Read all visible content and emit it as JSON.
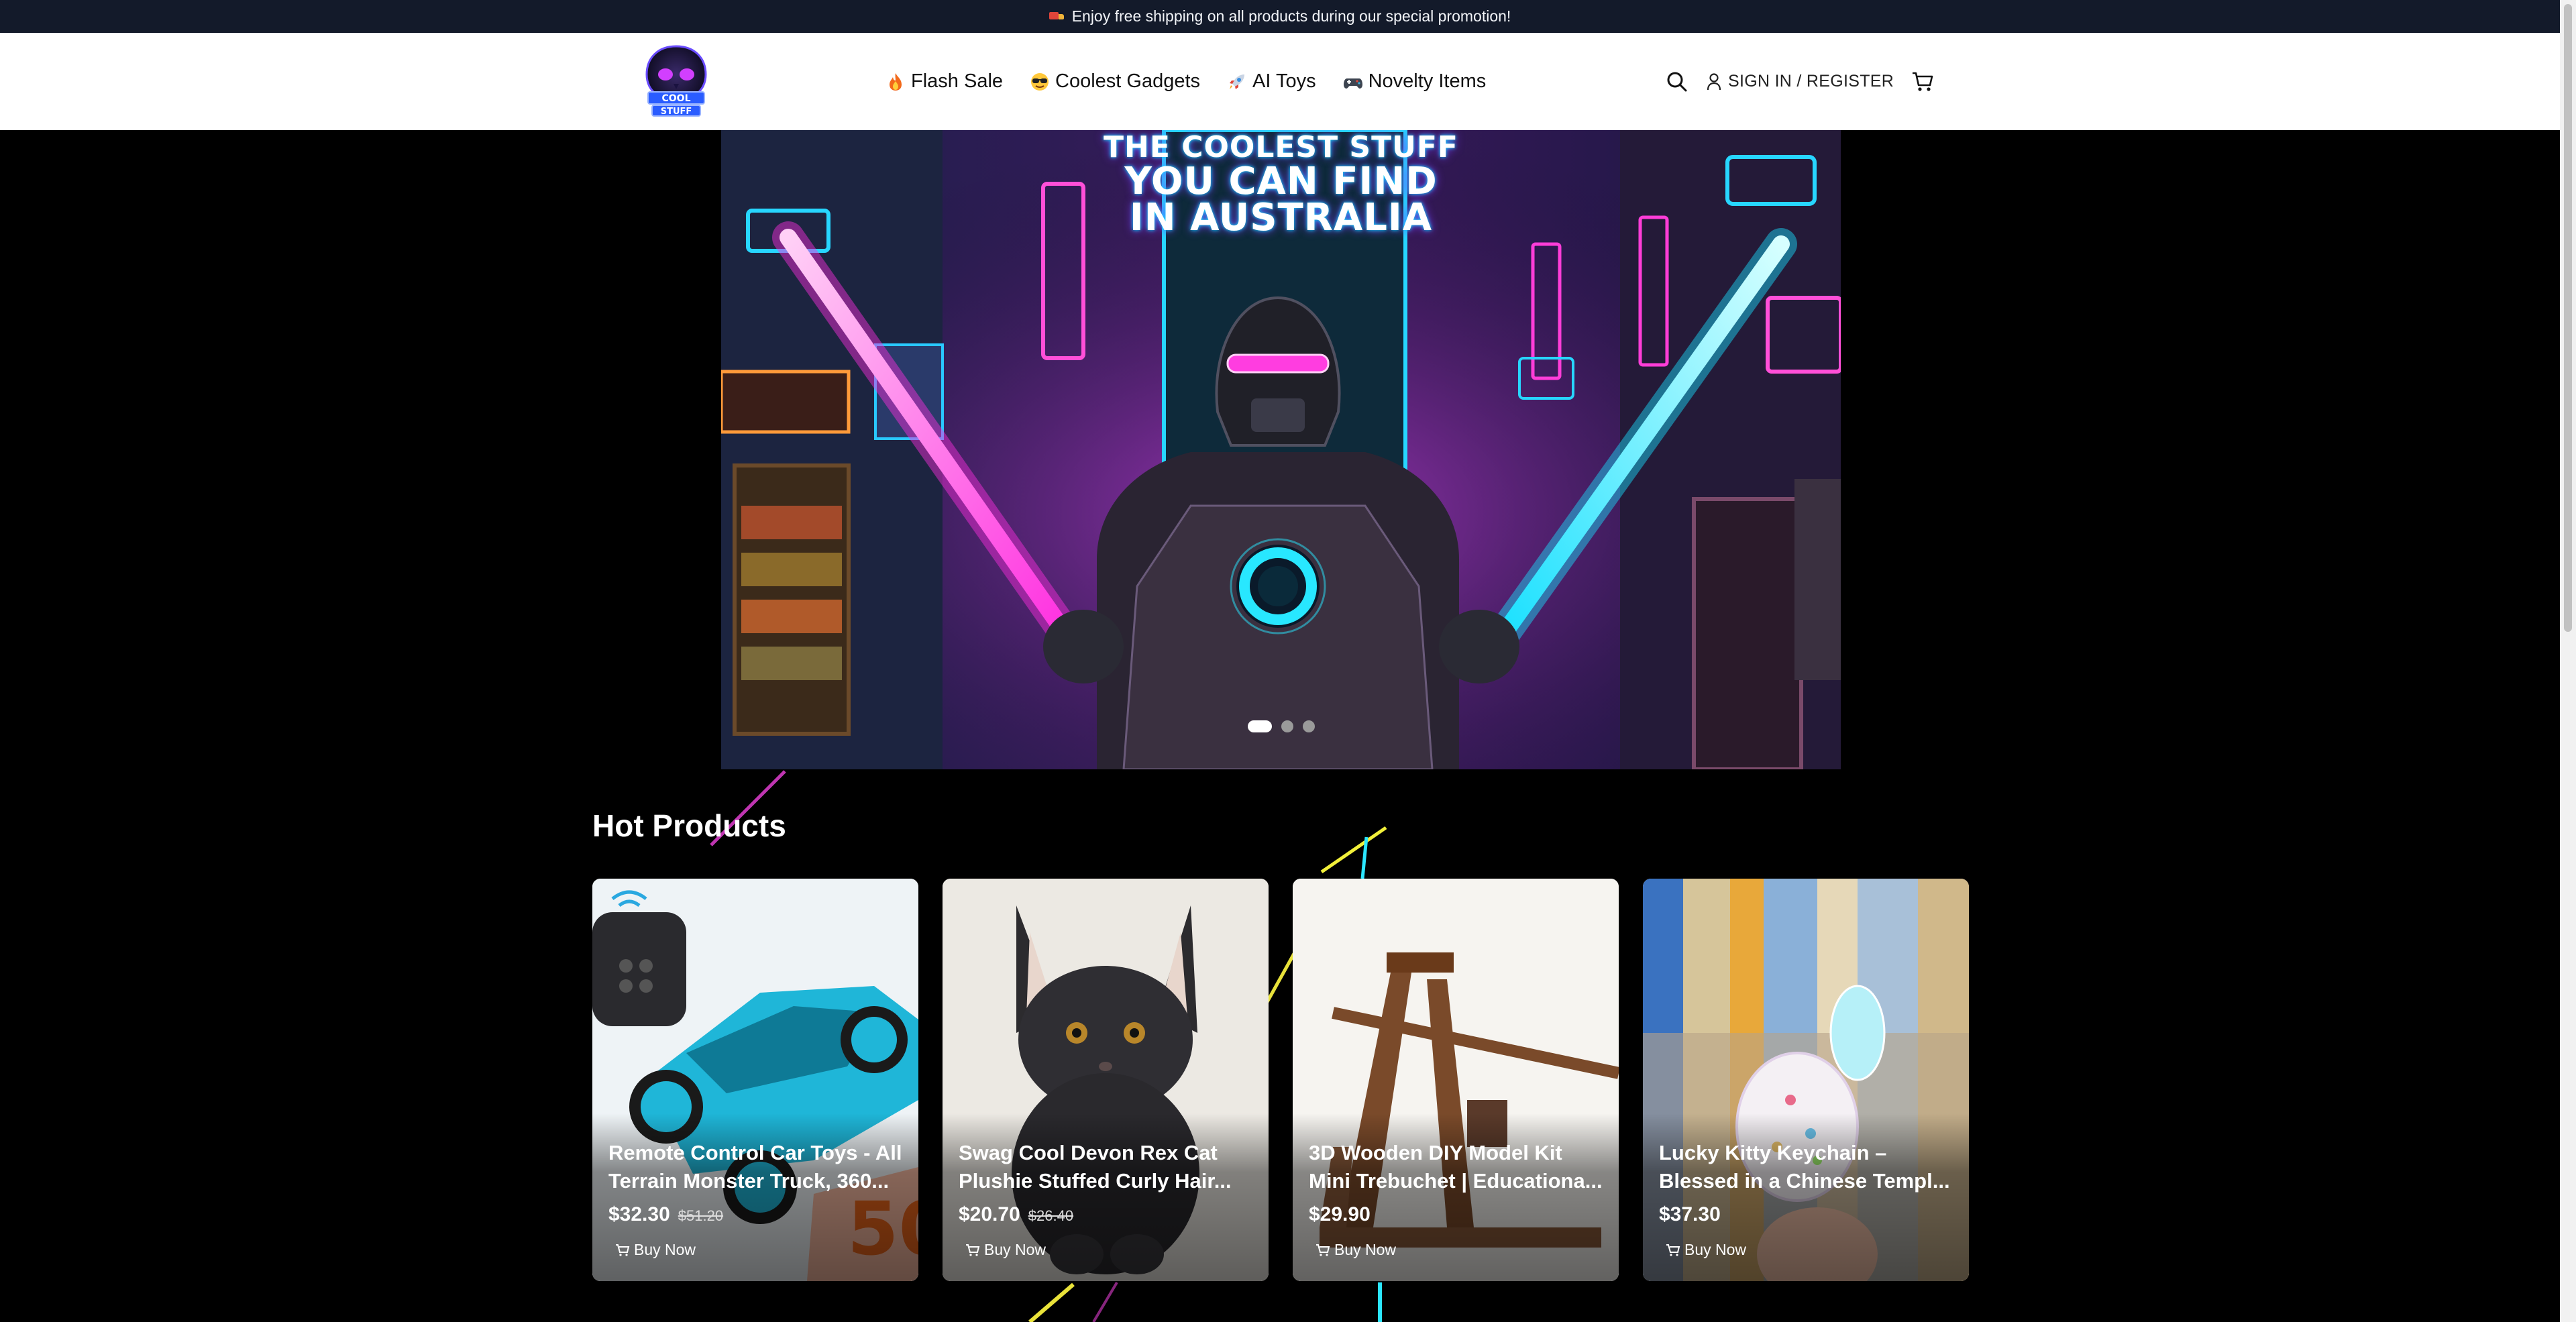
{
  "announcement": {
    "text": "Enjoy free shipping on all products during our special promotion!",
    "icon": "truck-icon"
  },
  "header": {
    "logo_text": [
      "COOL",
      "STUFF"
    ],
    "nav": [
      {
        "label": "Flash Sale",
        "icon": "fire-emoji"
      },
      {
        "label": "Coolest Gadgets",
        "icon": "sunglasses-emoji"
      },
      {
        "label": "AI Toys",
        "icon": "rocket-emoji"
      },
      {
        "label": "Novelty Items",
        "icon": "gamepad-emoji"
      }
    ],
    "signin_label": "SIGN IN / REGISTER"
  },
  "hero": {
    "lines": [
      "THE COOLEST STUFF",
      "YOU CAN FIND",
      "IN AUSTRALIA"
    ],
    "slides": 3,
    "active_slide": 1
  },
  "section": {
    "title": "Hot Products"
  },
  "products": [
    {
      "title": "Remote Control Car Toys - All Terrain Monster Truck, 360...",
      "price": "$32.30",
      "old_price": "$51.20",
      "buy_label": "Buy Now"
    },
    {
      "title": "Swag Cool Devon Rex Cat Plushie Stuffed Curly Hair...",
      "price": "$20.70",
      "old_price": "$26.40",
      "buy_label": "Buy Now"
    },
    {
      "title": "3D Wooden DIY Model Kit Mini Trebuchet | Educationa...",
      "price": "$29.90",
      "old_price": "",
      "buy_label": "Buy Now"
    },
    {
      "title": "Lucky Kitty Keychain – Blessed in a Chinese Templ...",
      "price": "$37.30",
      "old_price": "",
      "buy_label": "Buy Now"
    }
  ],
  "colors": {
    "announce_bg": "#131a2a",
    "neon_pink": "#ff3dd8",
    "neon_cyan": "#28e7ff",
    "neon_yellow": "#f5f032"
  }
}
